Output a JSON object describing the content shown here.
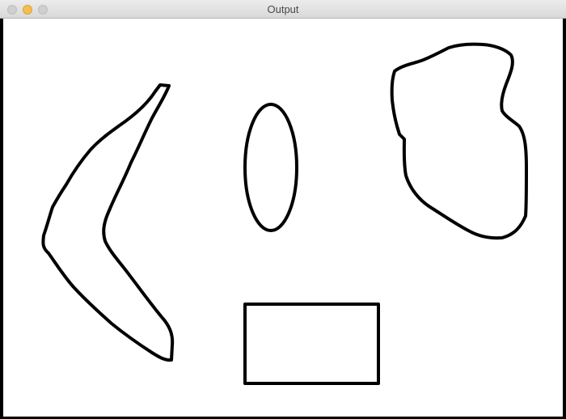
{
  "window": {
    "title": "Output"
  },
  "colors": {
    "canvas_background": "#ffffff",
    "stroke": "#000000",
    "minimize_button": "#f5bd4f",
    "inactive_button": "#cfcfcf"
  },
  "icons": {
    "close": "close-button-icon",
    "minimize": "minimize-button-icon",
    "maximize": "maximize-button-icon"
  },
  "shapes": [
    {
      "type": "boomerang",
      "style": "outline"
    },
    {
      "type": "ellipse",
      "style": "outline"
    },
    {
      "type": "irregular-blob",
      "style": "outline"
    },
    {
      "type": "rectangle",
      "style": "outline"
    }
  ]
}
